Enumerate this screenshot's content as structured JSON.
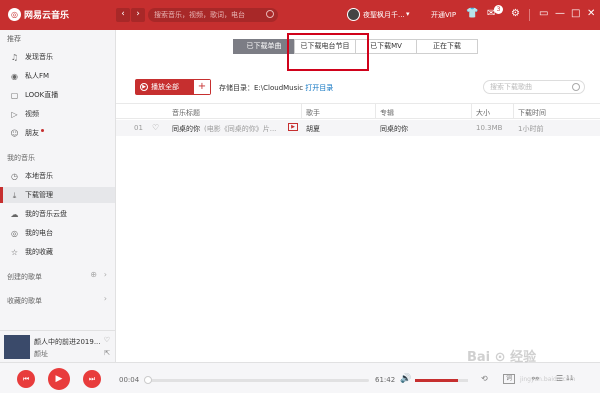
{
  "app": {
    "name": "网易云音乐",
    "logo_glyph": "◎"
  },
  "header": {
    "back_glyph": "‹",
    "forward_glyph": "›",
    "search_placeholder": "搜索音乐，视频，歌词，电台",
    "username": "夜聖枫月千...",
    "caret_glyph": "▾",
    "vip_label": "开通VIP",
    "skin_glyph": "👕",
    "message_glyph": "✉",
    "message_count": "3",
    "settings_glyph": "⚙",
    "mini_glyph": "▭",
    "minimize_glyph": "—",
    "maximize_glyph": "□",
    "close_glyph": "✕"
  },
  "sidebar": {
    "recommend_title": "推荐",
    "recommend_items": [
      {
        "label": "发现音乐",
        "icon": "♫"
      },
      {
        "label": "私人FM",
        "icon": "◉"
      },
      {
        "label": "LOOK直播",
        "icon": "▢"
      },
      {
        "label": "视频",
        "icon": "▷"
      },
      {
        "label": "朋友",
        "icon": "☺"
      }
    ],
    "my_music_title": "我的音乐",
    "my_music_items": [
      {
        "label": "本地音乐",
        "icon": "◷"
      },
      {
        "label": "下载管理",
        "icon": "⤓"
      },
      {
        "label": "我的音乐云盘",
        "icon": "☁"
      },
      {
        "label": "我的电台",
        "icon": "◎"
      },
      {
        "label": "我的收藏",
        "icon": "☆"
      }
    ],
    "created_playlists": "创建的歌单",
    "collected_playlists": "收藏的歌单",
    "add_glyph": "⊕",
    "expand_glyph": "›"
  },
  "now_playing": {
    "title": "颜人中的前进2019...",
    "artist": "颜址",
    "like_glyph": "♡",
    "share_glyph": "⇱"
  },
  "tabs": [
    {
      "label": "已下载单曲",
      "active": true
    },
    {
      "label": "已下载电台节目",
      "active": false
    },
    {
      "label": "已下载MV",
      "active": false
    },
    {
      "label": "正在下载",
      "active": false
    }
  ],
  "toolbar": {
    "play_all_label": "播放全部",
    "play_glyph": "▶",
    "add_glyph": "+",
    "storage_label": "存储目录：E:\\CloudMusic",
    "open_dir_label": "打开目录",
    "search_local_placeholder": "搜索下载歌曲"
  },
  "table": {
    "columns": [
      "音乐标题",
      "歌手",
      "专辑",
      "大小",
      "下载时间"
    ],
    "rows": [
      {
        "index": "01",
        "like_glyph": "♡",
        "title": "同桌的你",
        "subtitle": "(电影《同桌的你》片...",
        "mv_badge": "▶",
        "artist": "胡夏",
        "album": "同桌的你",
        "size": "10.3MB",
        "time": "1小时前"
      }
    ]
  },
  "player": {
    "prev_glyph": "⏮",
    "play_glyph": "▶",
    "next_glyph": "⏭",
    "current_time": "00:04",
    "total_time": "61:42",
    "progress_fraction": 0.01,
    "volume_fraction": 0.82,
    "volume_glyph": "🔊",
    "loop_glyph": "⟲",
    "lyric_label": "词",
    "share_glyph": "⚯",
    "playlist_glyph": "☰",
    "playlist_count": "11"
  },
  "watermark": {
    "text": "Bai ⊙ 经验",
    "sub": "jingyan.baidu.com"
  },
  "colors": {
    "brand_red": "#c62f2f",
    "highlight_box": "#d0021b"
  }
}
